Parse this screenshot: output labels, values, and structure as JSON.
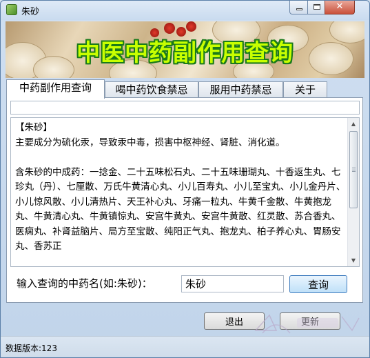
{
  "window": {
    "title": "朱砂"
  },
  "banner": {
    "title": "中医中药副作用查询"
  },
  "tabs": [
    {
      "label": "中药副作用查询",
      "active": true
    },
    {
      "label": "喝中药饮食禁忌",
      "active": false
    },
    {
      "label": "服用中药禁忌",
      "active": false
    },
    {
      "label": "关于",
      "active": false
    }
  ],
  "result": {
    "heading": "【朱砂】",
    "description": "主要成分为硫化汞，导致汞中毒，损害中枢神经、肾脏、消化道。",
    "formulas": "含朱砂的中成药：一捻金、二十五味松石丸、二十五味珊瑚丸、十香返生丸、七珍丸（丹）、七厘散、万氏牛黄清心丸、小儿百寿丸、小儿至宝丸、小儿金丹片、小儿惊风散、小儿清热片、天王补心丸、牙痛一粒丸、牛黄千金散、牛黄抱龙丸、牛黄清心丸、牛黄镇惊丸、安宫牛黄丸、安宫牛黄散、红灵散、苏合香丸、医痫丸、补肾益脑片、局方至宝散、纯阳正气丸、抱龙丸、柏子养心丸、胃肠安丸、香苏正"
  },
  "query": {
    "label": "输入查询的中药名(如:朱砂)：",
    "value": "朱砂",
    "button": "查询"
  },
  "buttons": {
    "exit": "退出",
    "update": "更新"
  },
  "statusbar": {
    "text": "数据版本:123"
  },
  "colors": {
    "banner_title": "#c8ff00",
    "banner_title_outline": "#1a7a1a",
    "close_button": "#c9503a"
  }
}
